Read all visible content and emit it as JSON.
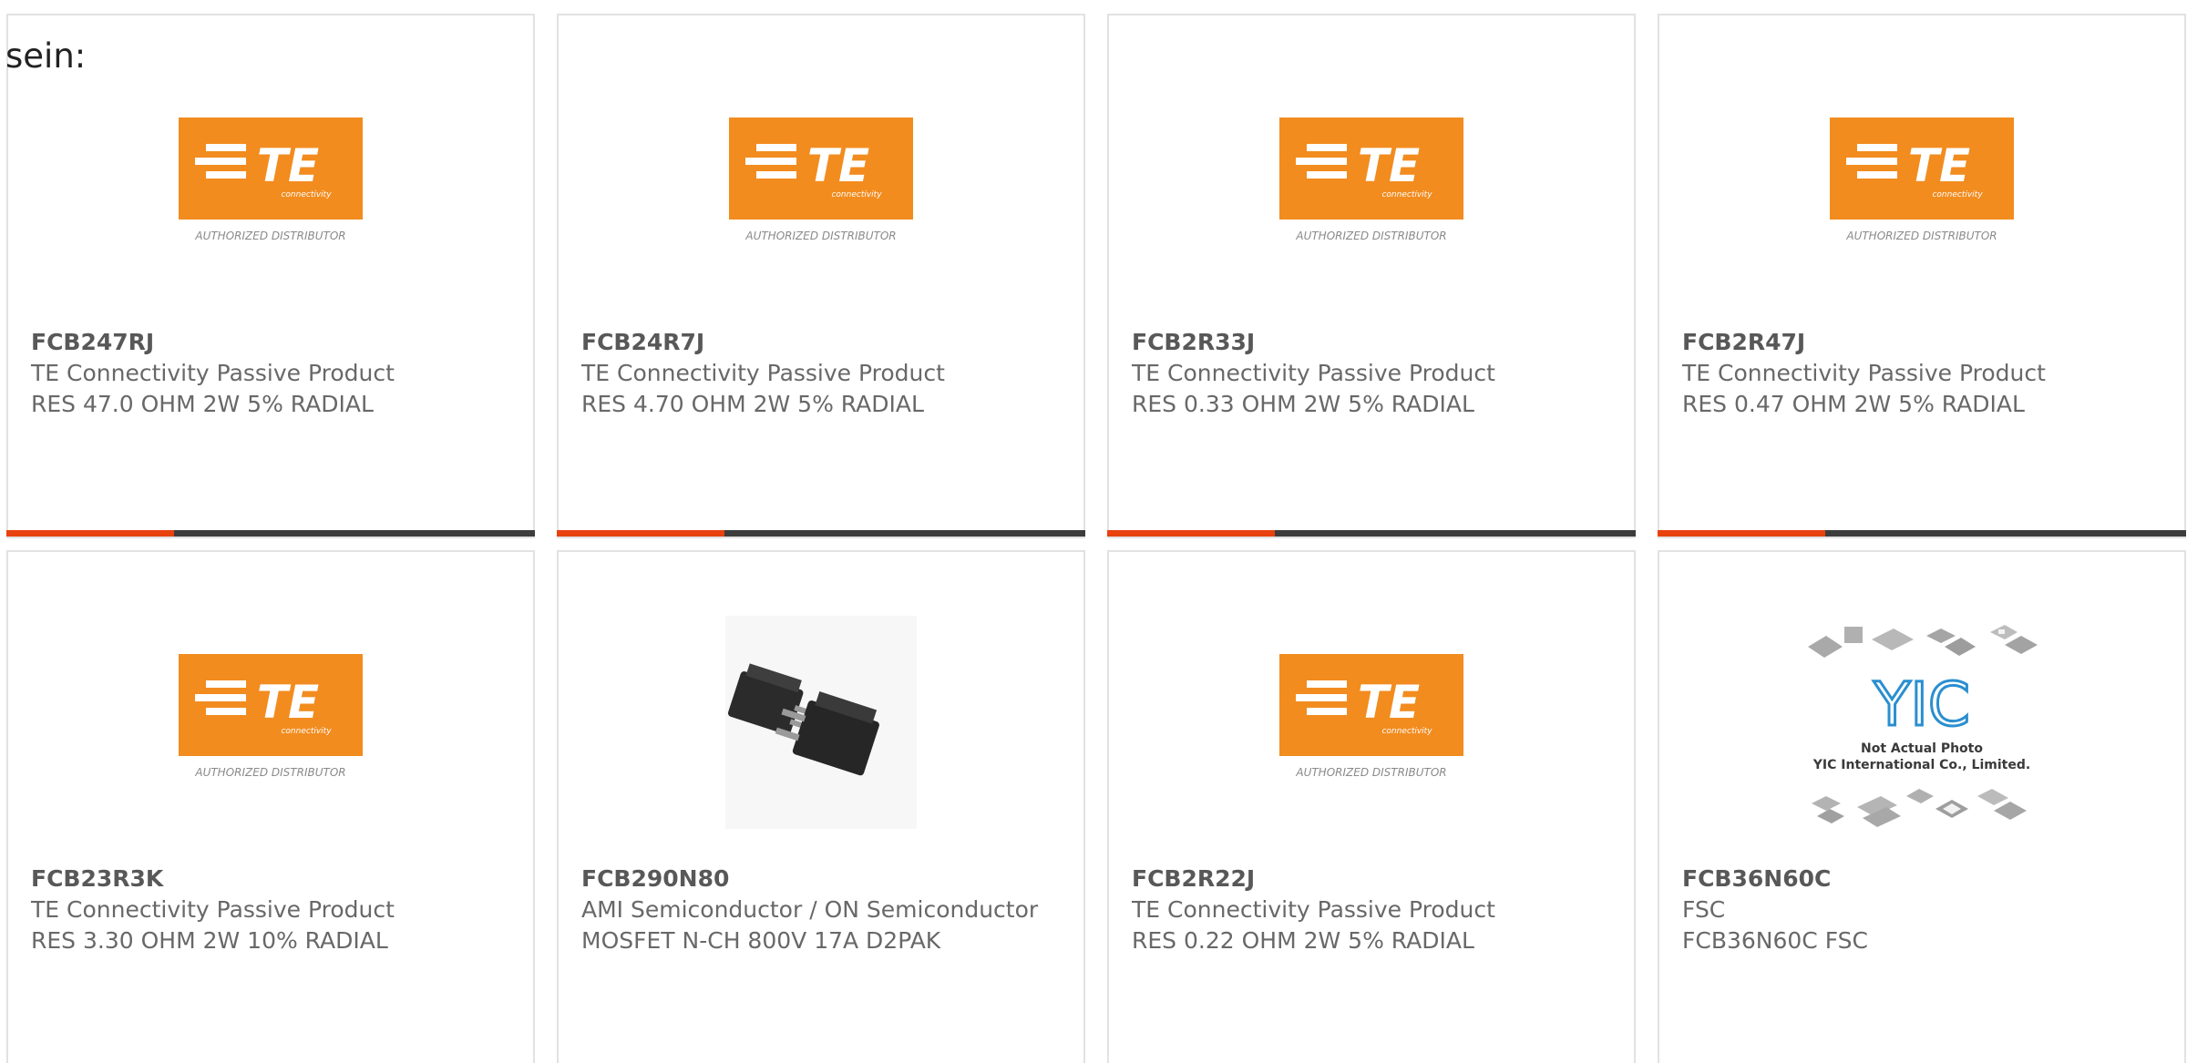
{
  "intro_text": "sein:",
  "colors": {
    "accent_bar": "#e8420f",
    "dark_bar": "#3c3c3c",
    "te_orange": "#f28c1f"
  },
  "logo": {
    "brand_word": "TE",
    "brand_sub": "connectivity",
    "caption": "AUTHORIZED DISTRIBUTOR"
  },
  "yic": {
    "logo_letters": "YIC",
    "line1": "Not Actual Photo",
    "line2": "YIC International Co., Limited."
  },
  "products": [
    {
      "part": "FCB247RJ",
      "manufacturer": "TE Connectivity Passive Product",
      "description": "RES 47.0 OHM 2W 5% RADIAL",
      "image": "te-logo"
    },
    {
      "part": "FCB24R7J",
      "manufacturer": "TE Connectivity Passive Product",
      "description": "RES 4.70 OHM 2W 5% RADIAL",
      "image": "te-logo"
    },
    {
      "part": "FCB2R33J",
      "manufacturer": "TE Connectivity Passive Product",
      "description": "RES 0.33 OHM 2W 5% RADIAL",
      "image": "te-logo"
    },
    {
      "part": "FCB2R47J",
      "manufacturer": "TE Connectivity Passive Product",
      "description": "RES 0.47 OHM 2W 5% RADIAL",
      "image": "te-logo"
    },
    {
      "part": "FCB23R3K",
      "manufacturer": "TE Connectivity Passive Product",
      "description": "RES 3.30 OHM 2W 10% RADIAL",
      "image": "te-logo"
    },
    {
      "part": "FCB290N80",
      "manufacturer": "AMI Semiconductor / ON Semiconductor",
      "description": "MOSFET N-CH 800V 17A D2PAK",
      "image": "d2pak-photo"
    },
    {
      "part": "FCB2R22J",
      "manufacturer": "TE Connectivity Passive Product",
      "description": "RES 0.22 OHM 2W 5% RADIAL",
      "image": "te-logo"
    },
    {
      "part": "FCB36N60C",
      "manufacturer": "FSC",
      "description": "FCB36N60C FSC",
      "image": "yic-placeholder"
    }
  ]
}
